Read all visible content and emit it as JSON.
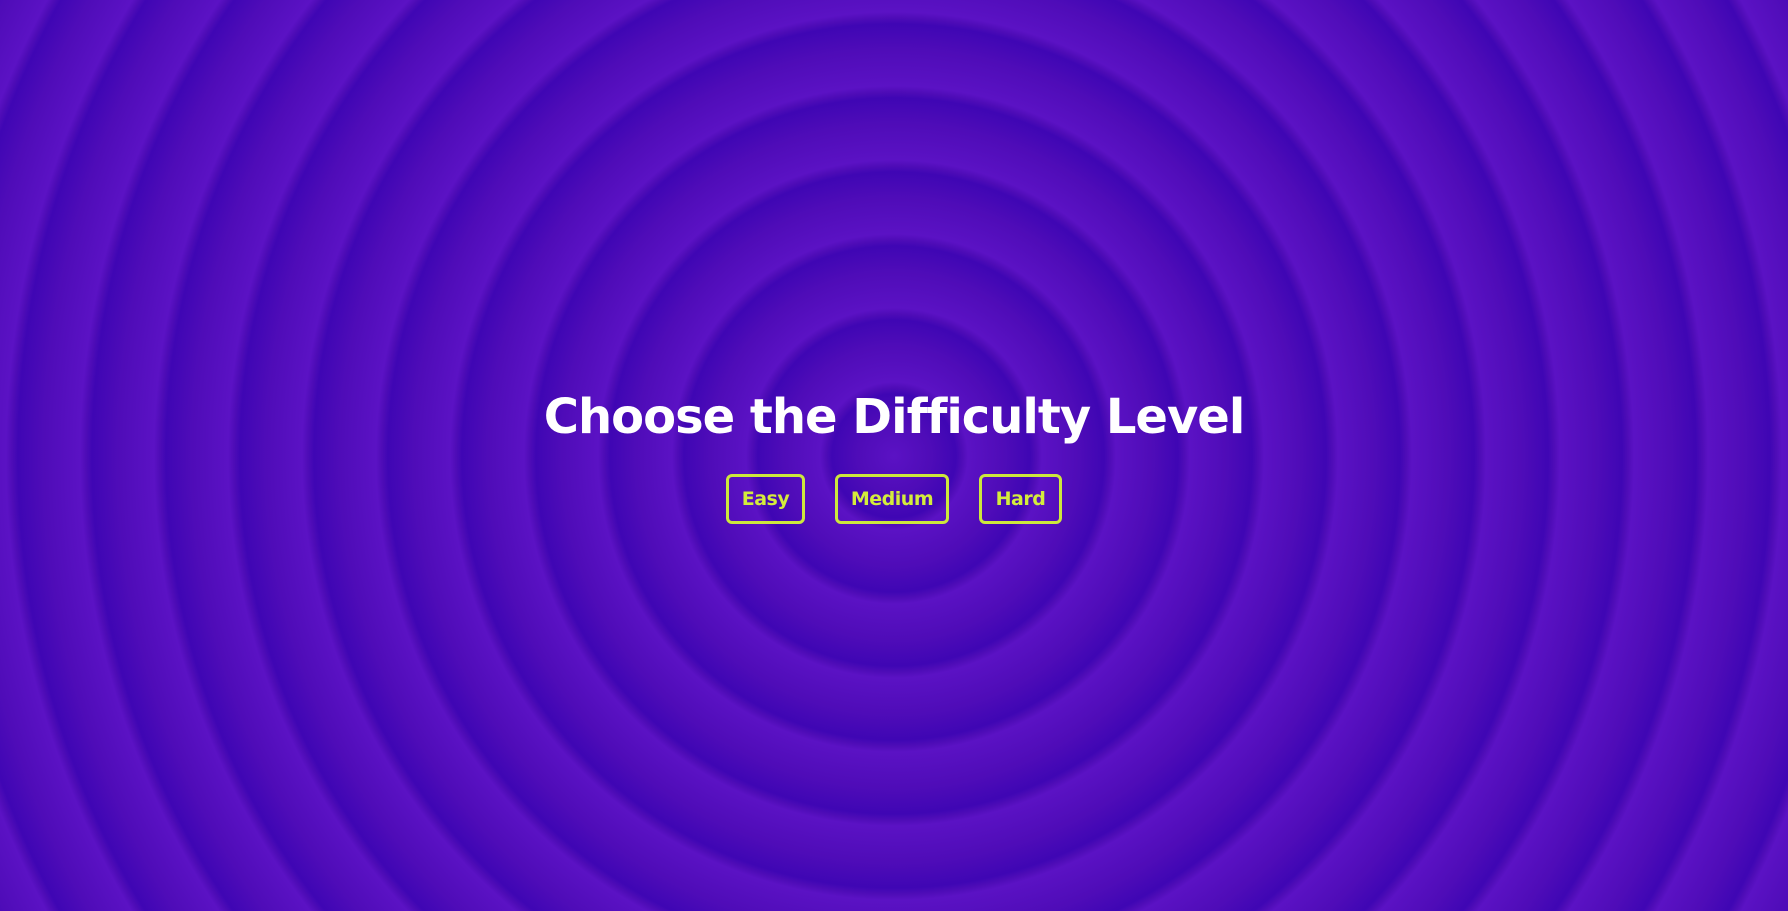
{
  "screen": {
    "title": "Choose the Difficulty Level"
  },
  "difficulty": {
    "options": [
      {
        "label": "Easy"
      },
      {
        "label": "Medium"
      },
      {
        "label": "Hard"
      }
    ]
  },
  "colors": {
    "background": "#4a0cb3",
    "ring_light": "#5b12c4",
    "ring_dark": "#3f06b4",
    "title_text": "#ffffff",
    "button_accent": "#d4ec3c"
  }
}
